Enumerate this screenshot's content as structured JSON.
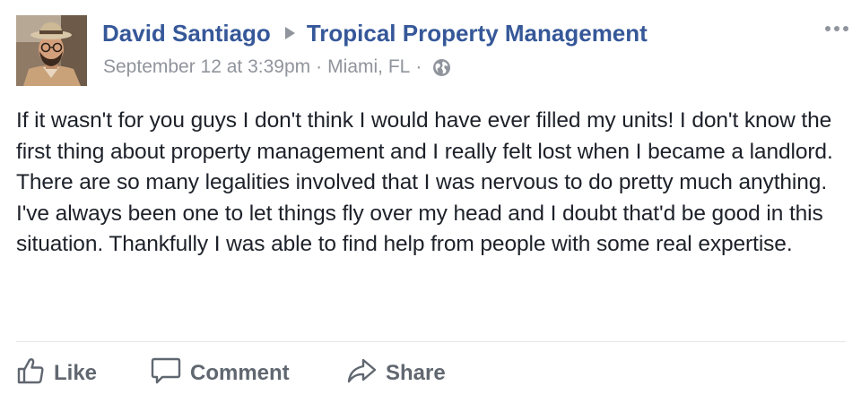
{
  "post": {
    "author": "David Santiago",
    "page": "Tropical Property Management",
    "timestamp": "September 12 at 3:39pm",
    "separator": "·",
    "location": "Miami, FL",
    "privacy_icon": "globe-icon",
    "more_icon": "more-options-icon",
    "body": "If it wasn't for you guys I don't think I would have ever filled my units! I don't know the first thing about property management and I really felt lost when I became a landlord. There are so many legalities involved that I was nervous to do pretty much anything. I've always been one to let things fly over my head and I doubt that'd be good in this situation. Thankfully I was able to find help from people with some real expertise."
  },
  "actions": {
    "like": "Like",
    "comment": "Comment",
    "share": "Share"
  },
  "colors": {
    "link": "#365899",
    "meta": "#90949c",
    "text": "#1d2129",
    "action": "#606770",
    "divider": "#e5e6e9"
  }
}
